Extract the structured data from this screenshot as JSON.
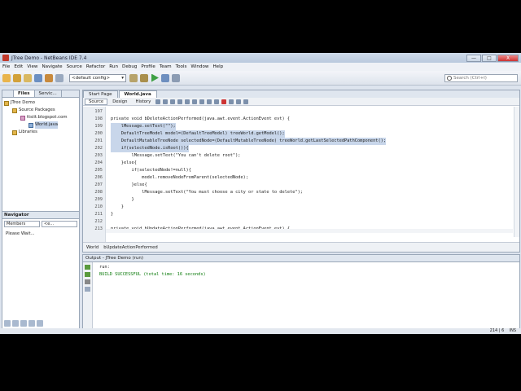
{
  "window": {
    "title": "JTree Demo - NetBeans IDE 7.4",
    "controls": [
      "—",
      "□",
      "X"
    ]
  },
  "menu": [
    "File",
    "Edit",
    "View",
    "Navigate",
    "Source",
    "Refactor",
    "Run",
    "Debug",
    "Profile",
    "Team",
    "Tools",
    "Window",
    "Help"
  ],
  "toolbar": {
    "config": "<default config>",
    "search_placeholder": "Search (Ctrl+I)"
  },
  "projects": {
    "tabs": [
      "Files",
      "Servic..."
    ],
    "tree": [
      {
        "label": "JTree Demo",
        "type": "project"
      },
      {
        "label": "Source Packages",
        "type": "folder"
      },
      {
        "label": "ttsiit.blogspot.com",
        "type": "package"
      },
      {
        "label": "World.java",
        "type": "java"
      },
      {
        "label": "Libraries",
        "type": "folder"
      }
    ]
  },
  "navigator": {
    "title": "Navigator",
    "members": "Members",
    "filter": "<e...",
    "status": "Please Wait..."
  },
  "editor": {
    "tabs": [
      "Start Page",
      "World.java"
    ],
    "subtabs": [
      "Source",
      "Design",
      "History"
    ],
    "lines": [
      {
        "n": "197",
        "t": ""
      },
      {
        "n": "198",
        "t": "private void bDeleteActionPerformed(java.awt.event.ActionEvent evt) {"
      },
      {
        "n": "199",
        "t": "    lMessage.setText(\"\");"
      },
      {
        "n": "200",
        "t": "    DefaultTreeModel model=(DefaultTreeModel) treeWorld.getModel();"
      },
      {
        "n": "201",
        "t": "    DefaultMutableTreeNode selectedNode=(DefaultMutableTreeNode) treeWorld.getLastSelectedPathComponent();"
      },
      {
        "n": "202",
        "t": "    if(selectedNode.isRoot()){"
      },
      {
        "n": "203",
        "t": "        lMessage.setText(\"You can't delete root\");"
      },
      {
        "n": "204",
        "t": "    }else{"
      },
      {
        "n": "205",
        "t": "        if(selectedNode!=null){"
      },
      {
        "n": "206",
        "t": "            model.removeNodeFromParent(selectedNode);"
      },
      {
        "n": "207",
        "t": "        }else{"
      },
      {
        "n": "208",
        "t": "            lMessage.setText(\"You must choose a city or state to delete\");"
      },
      {
        "n": "209",
        "t": "        }"
      },
      {
        "n": "210",
        "t": "    }"
      },
      {
        "n": "211",
        "t": "}"
      },
      {
        "n": "212",
        "t": ""
      },
      {
        "n": "213",
        "t": "private void bUpdateActionPerformed(java.awt.event.ActionEvent evt) {"
      }
    ],
    "breadcrumb": [
      "World",
      "bUpdateActionPerformed"
    ]
  },
  "output": {
    "title": "Output - JTree Demo (run)",
    "lines": [
      "run:",
      "BUILD SUCCESSFUL (total time: 16 seconds)"
    ]
  },
  "status": {
    "position": "214 | 6",
    "mode": "INS"
  }
}
